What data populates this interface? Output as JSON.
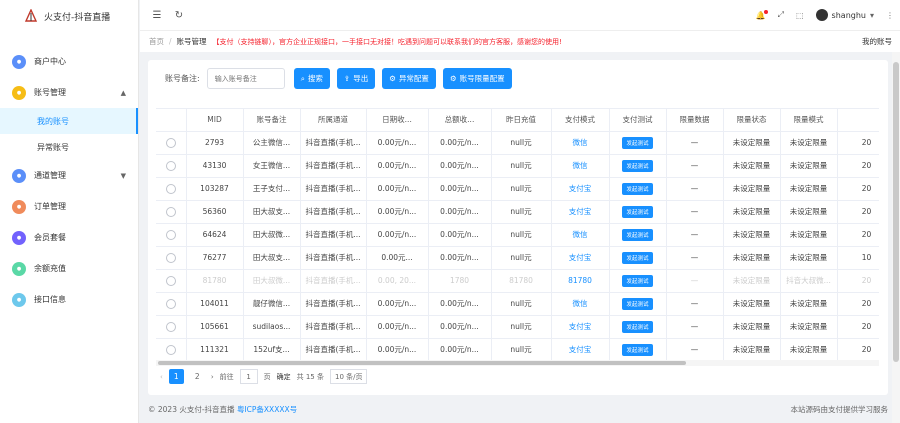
{
  "app": {
    "title": "火支付-抖音直播"
  },
  "sidebar": {
    "items": [
      {
        "label": "商户中心",
        "color": "#5b8ff9",
        "icon": "home-icon"
      },
      {
        "label": "账号管理",
        "color": "#f6bd16",
        "icon": "account-icon",
        "expanded": true
      },
      {
        "label": "通道管理",
        "color": "#5b8ff9",
        "icon": "channel-icon"
      },
      {
        "label": "订单管理",
        "color": "#f08b5b",
        "icon": "order-icon"
      },
      {
        "label": "会员套餐",
        "color": "#7262fd",
        "icon": "member-icon"
      },
      {
        "label": "余额充值",
        "color": "#5ad8a6",
        "icon": "recharge-icon"
      },
      {
        "label": "接口信息",
        "color": "#6dc8ec",
        "icon": "api-icon"
      }
    ],
    "subitems": [
      {
        "label": "我的账号",
        "active": true
      },
      {
        "label": "异常账号",
        "active": false
      }
    ]
  },
  "header": {
    "username": "shanghu"
  },
  "breadcrumb": {
    "home": "首页",
    "current": "账号管理",
    "notice": "【支付（支持链聊），官方企业正规接口，一手接口无对接！吃遇到问题可以联系我们的官方客服，感谢您的使用!",
    "right": "我的账号"
  },
  "toolbar": {
    "filter_label": "账号备注:",
    "filter_placeholder": "输入账号备注",
    "search": "搜索",
    "export": "导出",
    "abnormal": "异常配置",
    "limit": "账号限量配置"
  },
  "table": {
    "columns": [
      "",
      "MID",
      "账号备注",
      "所属通道",
      "日期收...",
      "总额收...",
      "昨日充值",
      "支付模式",
      "支付测试",
      "限量数据",
      "限量状态",
      "限量模式",
      ""
    ],
    "rows": [
      [
        "2793",
        "公主微信...",
        "抖音直播(手机...",
        "0.00元/n...",
        "0.00元/n...",
        "null元",
        "微信",
        "发起测试",
        "—",
        "未设定限量",
        "未设定限量",
        "20"
      ],
      [
        "43130",
        "女王微信...",
        "抖音直播(手机...",
        "0.00元/n...",
        "0.00元/n...",
        "null元",
        "微信",
        "发起测试",
        "—",
        "未设定限量",
        "未设定限量",
        "20"
      ],
      [
        "103287",
        "王子支付...",
        "抖音直播(手机...",
        "0.00元/n...",
        "0.00元/n...",
        "null元",
        "支付宝",
        "发起测试",
        "—",
        "未设定限量",
        "未设定限量",
        "20"
      ],
      [
        "56360",
        "田大叔支...",
        "抖音直播(手机...",
        "0.00元/n...",
        "0.00元/n...",
        "null元",
        "支付宝",
        "发起测试",
        "—",
        "未设定限量",
        "未设定限量",
        "20"
      ],
      [
        "64624",
        "田大叔微...",
        "抖音直播(手机...",
        "0.00元/n...",
        "0.00元/n...",
        "null元",
        "微信",
        "发起测试",
        "—",
        "未设定限量",
        "未设定限量",
        "20"
      ],
      [
        "76277",
        "田大叔支...",
        "抖音直播(手机...",
        "0.00元...",
        "0.00元/n...",
        "null元",
        "支付宝",
        "发起测试",
        "—",
        "未设定限量",
        "未设定限量",
        "10"
      ],
      [
        "81780",
        "田大叔微...",
        "抖音直播(手机...",
        "0.00, 20...",
        "1780",
        "81780",
        "81780",
        "发起测试",
        "—",
        "未设定限量",
        "抖音大叔微...",
        "20"
      ],
      [
        "104011",
        "靓仔微信...",
        "抖音直播(手机...",
        "0.00元/n...",
        "0.00元/n...",
        "null元",
        "微信",
        "发起测试",
        "—",
        "未设定限量",
        "未设定限量",
        "20"
      ],
      [
        "105661",
        "sudilaos...",
        "抖音直播(手机...",
        "0.00元/n...",
        "0.00元/n...",
        "null元",
        "支付宝",
        "发起测试",
        "—",
        "未设定限量",
        "未设定限量",
        "20"
      ],
      [
        "111321",
        "152uf支...",
        "抖音直播(手机...",
        "0.00元/n...",
        "0.00元/n...",
        "null元",
        "支付宝",
        "发起测试",
        "—",
        "未设定限量",
        "未设定限量",
        "20"
      ]
    ]
  },
  "pager": {
    "pages": [
      "1",
      "2"
    ],
    "goto": "前往",
    "page_value": "1",
    "page_suffix": "页",
    "confirm": "确定",
    "total": "共 15 条",
    "size": "10 条/页"
  },
  "footer": {
    "copy": "© 2023 火支付-抖音直播",
    "icp": "粤ICP备XXXXX号",
    "right": "本站源码由支付提供学习服务"
  }
}
